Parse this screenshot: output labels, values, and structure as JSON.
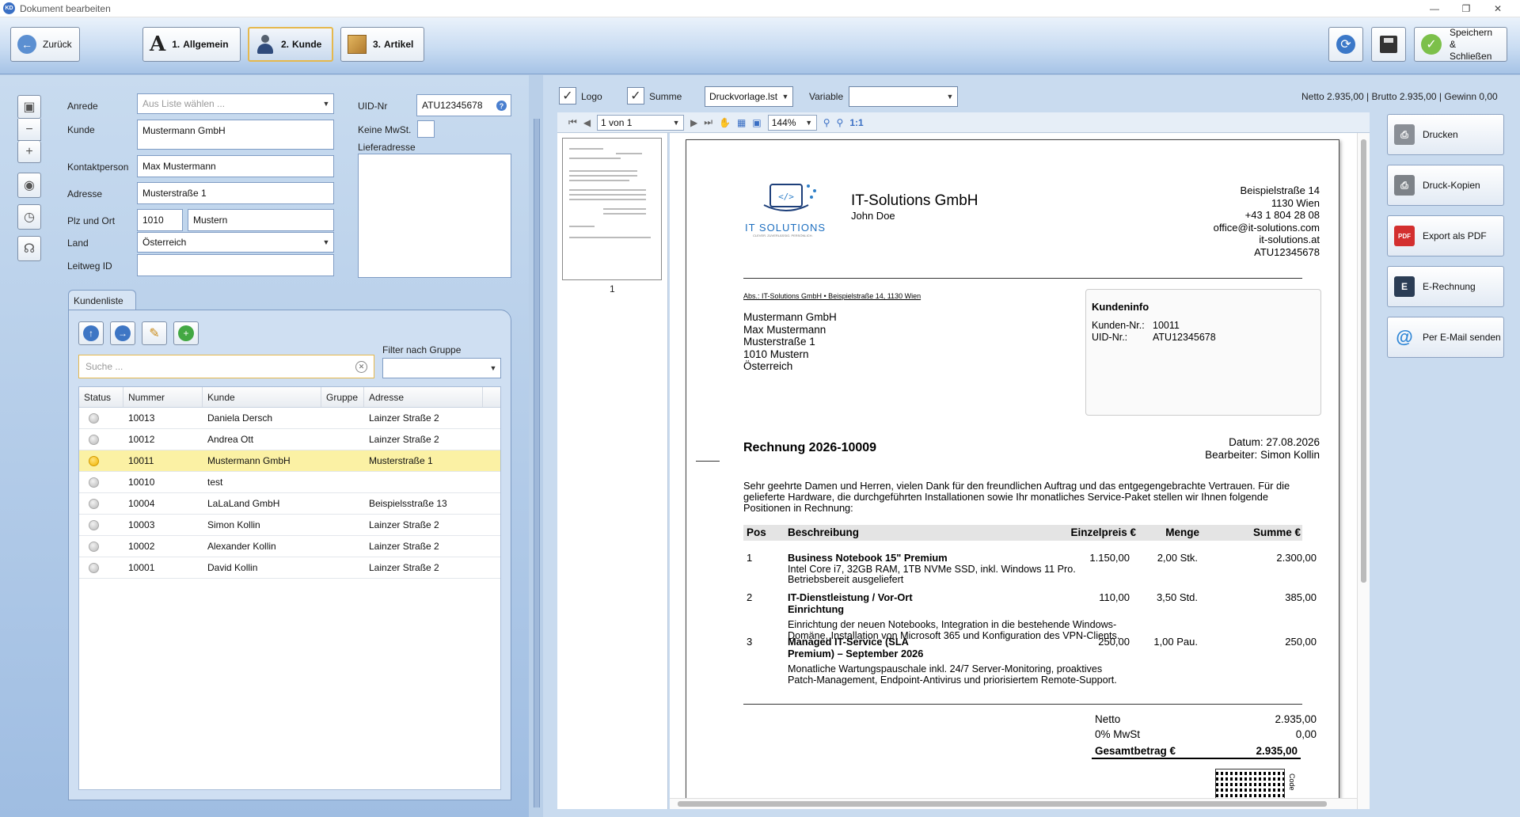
{
  "window": {
    "title": "Dokument bearbeiten",
    "app_icon": "KD"
  },
  "toolbar": {
    "back": "Zurück",
    "tabs": [
      {
        "num": "1.",
        "label": "Allgemein"
      },
      {
        "num": "2.",
        "label": "Kunde"
      },
      {
        "num": "3.",
        "label": "Artikel"
      }
    ],
    "save_close_1": "Speichern",
    "save_close_2": "& Schließen"
  },
  "form": {
    "anrede_label": "Anrede",
    "anrede_placeholder": "Aus Liste wählen ...",
    "kunde_label": "Kunde",
    "kunde_value": "Mustermann GmbH",
    "kontakt_label": "Kontaktperson",
    "kontakt_value": "Max Mustermann",
    "adresse_label": "Adresse",
    "adresse_value": "Musterstraße 1",
    "plz_label": "Plz und Ort",
    "plz_value": "1010",
    "ort_value": "Mustern",
    "land_label": "Land",
    "land_value": "Österreich",
    "leitweg_label": "Leitweg ID",
    "uid_label": "UID-Nr",
    "uid_value": "ATU12345678",
    "keine_mwst_label": "Keine MwSt.",
    "liefer_label": "Lieferadresse"
  },
  "kundenliste": {
    "tab": "Kundenliste",
    "filter_label": "Filter nach Gruppe",
    "search_placeholder": "Suche ...",
    "columns": [
      "Status",
      "Nummer",
      "Kunde",
      "Gruppe",
      "Adresse"
    ],
    "rows": [
      {
        "nummer": "10013",
        "kunde": "Daniela Dersch",
        "gruppe": "",
        "adresse": "Lainzer Straße 2",
        "selected": false
      },
      {
        "nummer": "10012",
        "kunde": "Andrea Ott",
        "gruppe": "",
        "adresse": "Lainzer Straße  2",
        "selected": false
      },
      {
        "nummer": "10011",
        "kunde": "Mustermann GmbH",
        "gruppe": "",
        "adresse": "Musterstraße 1",
        "selected": true
      },
      {
        "nummer": "10010",
        "kunde": "test",
        "gruppe": "",
        "adresse": "",
        "selected": false
      },
      {
        "nummer": "10004",
        "kunde": "LaLaLand GmbH",
        "gruppe": "",
        "adresse": "Beispielsstraße 13",
        "selected": false
      },
      {
        "nummer": "10003",
        "kunde": "Simon Kollin",
        "gruppe": "",
        "adresse": "Lainzer Straße 2",
        "selected": false
      },
      {
        "nummer": "10002",
        "kunde": "Alexander Kollin",
        "gruppe": "",
        "adresse": "Lainzer Straße 2",
        "selected": false
      },
      {
        "nummer": "10001",
        "kunde": "David Kollin",
        "gruppe": "",
        "adresse": "Lainzer Straße 2",
        "selected": false
      }
    ]
  },
  "preview_bar": {
    "logo": "Logo",
    "summe": "Summe",
    "template": "Druckvorlage.lst",
    "variable": "Variable",
    "summary": "Netto 2.935,00 | Brutto 2.935,00 | Gewinn 0,00",
    "page": "1 von 1",
    "zoom": "144%",
    "one_to_one": "1:1",
    "thumb_page": "1"
  },
  "side_buttons": [
    "Drucken",
    "Druck-Kopien",
    "Export als PDF",
    "E-Rechnung",
    "Per E-Mail senden"
  ],
  "invoice": {
    "company": "IT-Solutions GmbH",
    "person": "John Doe",
    "logo_text": "IT SOLUTIONS",
    "logo_tagline": "CLEVER. ZUVERLÄSSIG. PERSÖNLICH.",
    "address_lines": [
      "Beispielstraße 14",
      "1130 Wien",
      "+43 1 804 28 08",
      "office@it-solutions.com",
      "it-solutions.at",
      "ATU12345678"
    ],
    "sender_line": "Abs.: IT-Solutions GmbH • Beispielstraße 14, 1130 Wien",
    "recipient": [
      "Mustermann GmbH",
      "Max Mustermann",
      "Musterstraße 1",
      "1010 Mustern",
      "Österreich"
    ],
    "kundeninfo_title": "Kundeninfo",
    "kundennr_label": "Kunden-Nr.:",
    "kundennr": "10011",
    "uid_label": "UID-Nr.:",
    "uid": "ATU12345678",
    "title": "Rechnung 2026-10009",
    "datum": "Datum: 27.08.2026",
    "bearbeiter": "Bearbeiter: Simon Kollin",
    "intro_lines": [
      "Sehr geehrte Damen und Herren, vielen Dank für den freundlichen Auftrag und das entgegengebrachte Vertrauen. Für die",
      "gelieferte Hardware, die durchgeführten Installationen sowie Ihr monatliches Service-Paket stellen wir Ihnen folgende",
      "Positionen in Rechnung:"
    ],
    "cols": [
      "Pos",
      "Beschreibung",
      "Einzelpreis €",
      "Menge",
      "Summe €"
    ],
    "items": [
      {
        "pos": "1",
        "title": [
          "Business Notebook 15\" Premium"
        ],
        "desc": [
          "Intel Core i7, 32GB RAM, 1TB NVMe SSD, inkl. Windows 11 Pro.",
          "Betriebsbereit ausgeliefert"
        ],
        "price": "1.150,00",
        "qty": "2,00 Stk.",
        "sum": "2.300,00"
      },
      {
        "pos": "2",
        "title": [
          "IT-Dienstleistung / Vor-Ort",
          "Einrichtung"
        ],
        "desc": [
          "Einrichtung der neuen Notebooks, Integration in die bestehende Windows-",
          "Domäne, Installation von Microsoft 365 und Konfiguration des VPN-Clients."
        ],
        "price": "110,00",
        "qty": "3,50 Std.",
        "sum": "385,00"
      },
      {
        "pos": "3",
        "title": [
          "Managed IT-Service (SLA",
          "Premium) – September 2026"
        ],
        "desc": [
          "Monatliche Wartungspauschale inkl. 24/7 Server-Monitoring, proaktives",
          "Patch-Management, Endpoint-Antivirus und priorisiertem Remote-Support."
        ],
        "price": "250,00",
        "qty": "1,00 Pau.",
        "sum": "250,00"
      }
    ],
    "netto_label": "Netto",
    "netto": "2.935,00",
    "mwst_label": "0% MwSt",
    "mwst": "0,00",
    "gesamt_label": "Gesamtbetrag €",
    "gesamt": "2.935,00",
    "qr_label": "Code"
  },
  "colors": {
    "accent": "#e5b84d",
    "selected_row": "#fbf1a4",
    "toolbar_top": "#eaf2fb",
    "panel": "#b9cfe8"
  }
}
